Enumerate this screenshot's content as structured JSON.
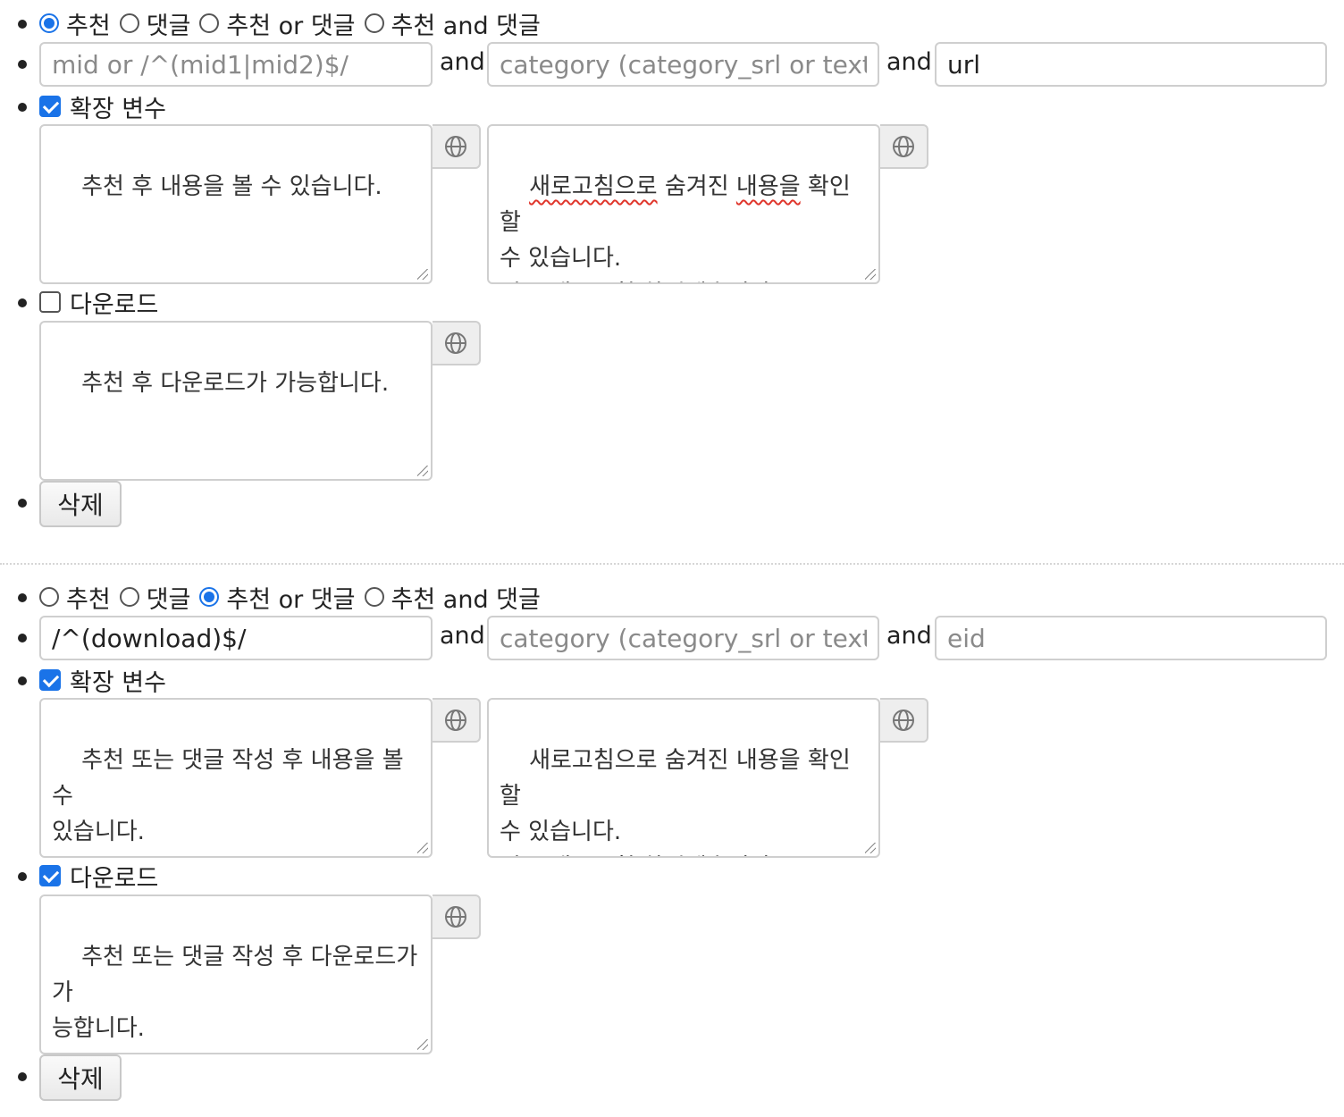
{
  "and_label": "and",
  "lang_icon": "globe-icon",
  "accent_color": "#1a73e8",
  "rules": [
    {
      "radios": [
        {
          "label": "추천",
          "checked": true
        },
        {
          "label": "댓글",
          "checked": false
        },
        {
          "label": "추천 or 댓글",
          "checked": false
        },
        {
          "label": "추천 and 댓글",
          "checked": false
        }
      ],
      "mid": {
        "value": "",
        "placeholder": "mid or /^(mid1|mid2)$/"
      },
      "category": {
        "value": "",
        "placeholder": "category (category_srl or text)"
      },
      "third": {
        "value": "url",
        "placeholder": ""
      },
      "extra_vars": {
        "label": "확장 변수",
        "checked": true
      },
      "content_msg": "추천 후 내용을 볼 수 있습니다.",
      "refresh_msg_line1_a": "새로고침으로",
      "refresh_msg_line1_b": " 숨겨진 ",
      "refresh_msg_line1_c": "내용을",
      "refresh_msg_line1_d": " 확인할",
      "refresh_msg_rest": "수 있습니다.\n지금 새로고침 하시겠습니까?",
      "download": {
        "label": "다운로드",
        "checked": false
      },
      "download_msg": "추천 후 다운로드가 가능합니다.",
      "delete_label": "삭제"
    },
    {
      "radios": [
        {
          "label": "추천",
          "checked": false
        },
        {
          "label": "댓글",
          "checked": false
        },
        {
          "label": "추천 or 댓글",
          "checked": true
        },
        {
          "label": "추천 and 댓글",
          "checked": false
        }
      ],
      "mid": {
        "value": "/^(download)$/",
        "placeholder": ""
      },
      "category": {
        "value": "",
        "placeholder": "category (category_srl or text)"
      },
      "third": {
        "value": "",
        "placeholder": "eid"
      },
      "extra_vars": {
        "label": "확장 변수",
        "checked": true
      },
      "content_msg": "추천 또는 댓글 작성 후 내용을 볼 수\n있습니다.",
      "refresh_msg": "새로고침으로 숨겨진 내용을 확인할\n수 있습니다.\n지금 새로고침 하시겠습니까?",
      "download": {
        "label": "다운로드",
        "checked": true
      },
      "download_msg": "추천 또는 댓글 작성 후 다운로드가 가\n능합니다.",
      "delete_label": "삭제"
    }
  ]
}
